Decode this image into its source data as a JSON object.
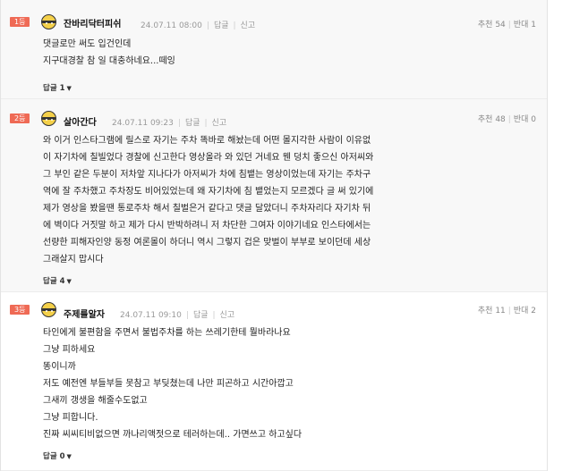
{
  "comments": [
    {
      "rank": "1등",
      "nickname": "잔바리닥터피쉬",
      "time": "24.07.11 08:00",
      "reply_label": "답글",
      "report_label": "신고",
      "upvote_label": "추천",
      "upvotes": "54",
      "downvote_label": "반대",
      "downvotes": "1",
      "lines": [
        "댓글로만 써도 입건인데",
        "지구대경찰 참 일 대충하네요...떼잉"
      ],
      "replies_label": "답글",
      "replies_count": "1"
    },
    {
      "rank": "2등",
      "nickname": "살아간다",
      "time": "24.07.11 09:23",
      "reply_label": "답글",
      "report_label": "신고",
      "upvote_label": "추천",
      "upvotes": "48",
      "downvote_label": "반대",
      "downvotes": "0",
      "lines": [
        "와 이거 인스타그램에 릴스로 자기는 주차 똑바로 해놨는데 어떤 몰지각한 사람이 이유없",
        "이 자기차에 칠빌었다 경찰에 신고한다 영상올라 와 있던 거네요 웬 덩치 좋으신 아저씨와",
        "그 부인 같은 두분이 저차앞 지나다가 아저씨가 차에 침뱉는 영상이었는데 자기는 주차구",
        "역에 잘 주차했고 주차장도 비어있었는데 왜 자기차에 침 뱉었는지 모르겠다 글 써 있기에",
        "제가 영상을 봤을땐 통로주차 해서 칠벌은거 같다고 댓글 달았더니 주차자리다 자기차 뒤",
        "에 벽이다 거짓말 하고 제가 다시 반박하려니 저 차단한 그여자 이야기네요 인스타에서는",
        "선량한 피해자인양 동정 여론몰이 하더니 역시 그렇지 겁은 맞벌이 부부로 보이던데 세상",
        "그래살지 맙시다"
      ],
      "replies_label": "답글",
      "replies_count": "4"
    },
    {
      "rank": "3등",
      "nickname": "주제를알자",
      "time": "24.07.11 09:10",
      "reply_label": "답글",
      "report_label": "신고",
      "upvote_label": "추천",
      "upvotes": "11",
      "downvote_label": "반대",
      "downvotes": "2",
      "lines": [
        "타인에게 불편함을 주면서 불법주차를 하는 쓰레기한테 뭘바라나요",
        "그냥 피하세요",
        "똥이니까",
        "저도 예전엔 부들부들 못참고 부딪쳤는데 나만 피곤하고 시간아깝고",
        "그새끼 갱생을 해줄수도없고",
        "그냥 피합니다.",
        "진짜 씨씨티비없으면 까나리액젓으로 테러하는데.. 가면쓰고 하고싶다"
      ],
      "replies_label": "답글",
      "replies_count": "0"
    }
  ],
  "icons": {
    "avatar": "avatar-icon",
    "replies_toggle": "chevron-down-icon"
  },
  "colors": {
    "rank_badge": "#ef6a55",
    "best_bg": "#f8f8f8",
    "meta_text": "#999999"
  }
}
